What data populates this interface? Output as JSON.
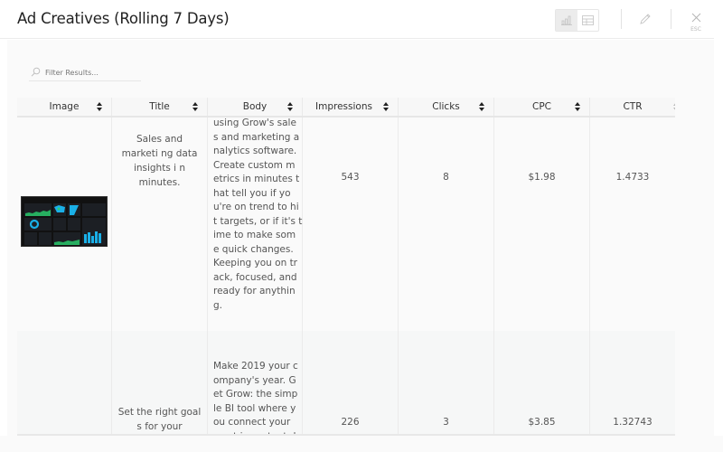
{
  "header": {
    "title": "Ad Creatives (Rolling 7 Days)",
    "view_toggle": {
      "chart_icon": "bar-chart-icon",
      "table_icon": "table-icon",
      "active": "chart"
    },
    "edit_icon": "pencil-icon",
    "close_icon": "close-icon",
    "close_label": "ESC"
  },
  "filter": {
    "placeholder": "Filter Results...",
    "value": "",
    "icon": "search-icon"
  },
  "table": {
    "columns": [
      {
        "label": "Image",
        "sortable": true
      },
      {
        "label": "Title",
        "sortable": true
      },
      {
        "label": "Body",
        "sortable": true
      },
      {
        "label": "Impressions",
        "sortable": true
      },
      {
        "label": "Clicks",
        "sortable": true
      },
      {
        "label": "CPC",
        "sortable": true
      },
      {
        "label": "CTR",
        "sortable": true
      }
    ],
    "rows": [
      {
        "image": "dashboard-thumbnail",
        "title": "Sales and marketi ng data insights i n minutes.",
        "body_lines": [
          "using Grow's sale",
          "s and marketing a",
          "nalytics software.",
          "Create custom m",
          "etrics in minutes t",
          "hat tell you if yo",
          "u're on trend to hi",
          "t targets, or if it's t",
          "ime to make som",
          "e quick changes.",
          "Keeping you on tr",
          "ack, focused, and",
          "ready for anythin",
          "g."
        ],
        "impressions": "543",
        "clicks": "8",
        "cpc": "$1.98",
        "ctr": "1.4733"
      },
      {
        "image": "",
        "title": "Set the right goal s for your busines s.",
        "body_lines": [
          "Make 2019 your c",
          "ompany's year. G",
          "et Grow: the simp",
          "le BI tool where y",
          "ou connect your",
          "most important d"
        ],
        "impressions": "226",
        "clicks": "3",
        "cpc": "$3.85",
        "ctr": "1.32743"
      }
    ]
  },
  "colors": {
    "chart_green": "#2ecc71",
    "chart_cyan": "#1ab0e8",
    "thumb_bg": "#111111"
  }
}
